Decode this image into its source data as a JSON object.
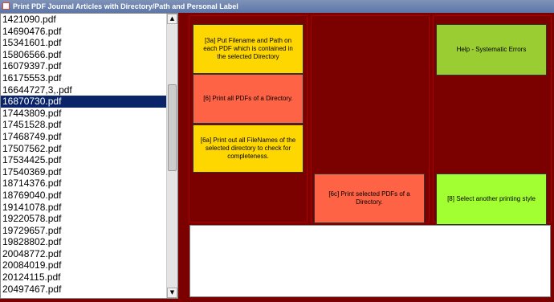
{
  "window": {
    "title": "Print PDF Journal Articles with Directory/Path and Personal Label"
  },
  "file_list": {
    "items": [
      "1421090.pdf",
      "14690476.pdf",
      "15341601.pdf",
      "15806566.pdf",
      "16079397.pdf",
      "16175553.pdf",
      "16644727,3,.pdf",
      "16870730.pdf",
      "17443809.pdf",
      "17451528.pdf",
      "17468749.pdf",
      "17507562.pdf",
      "17534425.pdf",
      "17540369.pdf",
      "18714376.pdf",
      "18769040.pdf",
      "19141078.pdf",
      "19220578.pdf",
      "19729657.pdf",
      "19828802.pdf",
      "20048772.pdf",
      "20084019.pdf",
      "20124115.pdf",
      "20497467.pdf"
    ],
    "selected": "16870730.pdf"
  },
  "scrollbar": {
    "up_glyph": "▲",
    "down_glyph": "▼"
  },
  "buttons": {
    "put_filename": "[3a] Put Filename and Path on each PDF which is contained in the selected Directory",
    "print_all": "[6] Print all PDFs of a Directory.",
    "print_filenames": "[6a] Print out all FileNames of the selected directory to check for completeness.",
    "print_selected": "[6c] Print selected PDFs of a Directory.",
    "help_errors": "Help - Systematic Errors",
    "select_style": "[8] Select another printing style"
  },
  "colors": {
    "background": "#7b0000",
    "yellow_button": "#ffd700",
    "orange_button": "#ff6346",
    "green_button": "#9acd32",
    "lime_button": "#a2ff32",
    "selection": "#0a246a"
  },
  "output_box": {
    "text": ""
  }
}
